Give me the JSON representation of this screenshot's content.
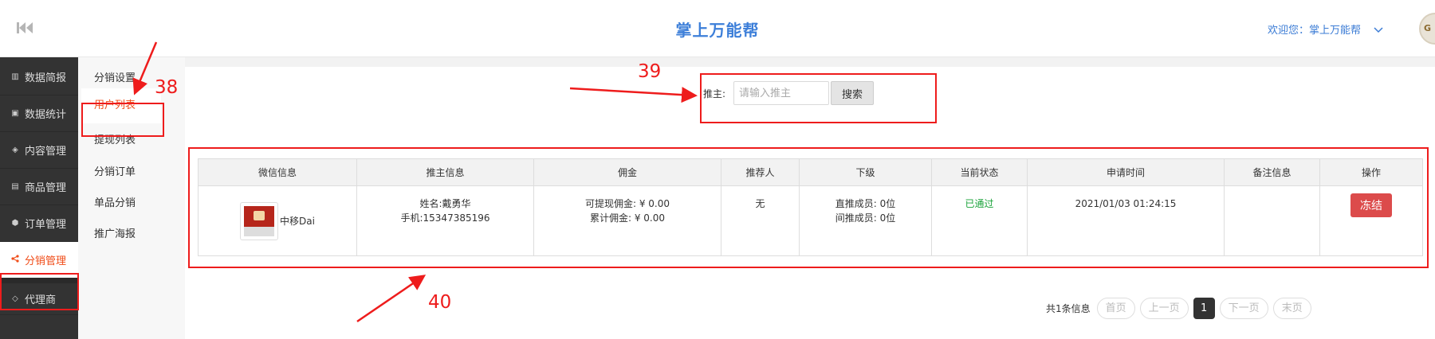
{
  "header": {
    "title": "掌上万能帮",
    "welcome": "欢迎您：掌上万能帮",
    "avatar_text": "G"
  },
  "sidebar": {
    "items": [
      {
        "label": "数据简报",
        "icon": "bar-chart-icon"
      },
      {
        "label": "数据统计",
        "icon": "money-icon"
      },
      {
        "label": "内容管理",
        "icon": "tag-icon"
      },
      {
        "label": "商品管理",
        "icon": "bag-icon"
      },
      {
        "label": "订单管理",
        "icon": "cube-icon"
      },
      {
        "label": "分销管理",
        "icon": "share-icon",
        "active": true
      },
      {
        "label": "代理商",
        "icon": "diamond-icon"
      }
    ]
  },
  "subnav": {
    "items": [
      {
        "label": "分销设置"
      },
      {
        "label": "用户列表",
        "active": true
      },
      {
        "label": "提现列表"
      },
      {
        "label": "分销订单"
      },
      {
        "label": "单品分销"
      },
      {
        "label": "推广海报"
      }
    ]
  },
  "search": {
    "label": "推主:",
    "placeholder": "请输入推主",
    "button": "搜索"
  },
  "table": {
    "columns": [
      "微信信息",
      "推主信息",
      "佣金",
      "推荐人",
      "下级",
      "当前状态",
      "申请时间",
      "备注信息",
      "操作"
    ],
    "rows": [
      {
        "wx_name": "中移Dai",
        "name_line": "姓名:戴勇华",
        "phone_line": "手机:15347385196",
        "commission_withdrawable": "可提现佣金: ¥ 0.00",
        "commission_total": "累计佣金: ¥ 0.00",
        "referrer": "无",
        "direct_members": "直推成员: 0位",
        "indirect_members": "间推成员: 0位",
        "status": "已通过",
        "apply_time": "2021/01/03 01:24:15",
        "remark": "",
        "action": "冻结"
      }
    ]
  },
  "pager": {
    "total": "共1条信息",
    "first": "首页",
    "prev": "上一页",
    "current": "1",
    "next": "下一页",
    "last": "末页"
  },
  "annotations": {
    "n38": "38",
    "n39": "39",
    "n40": "40",
    "color": "#ee1c1c"
  },
  "colors": {
    "brand_blue": "#3d7fd9",
    "active_orange": "#f04c18",
    "danger_red": "#dc4b4b",
    "pass_green": "#1aa33a"
  }
}
